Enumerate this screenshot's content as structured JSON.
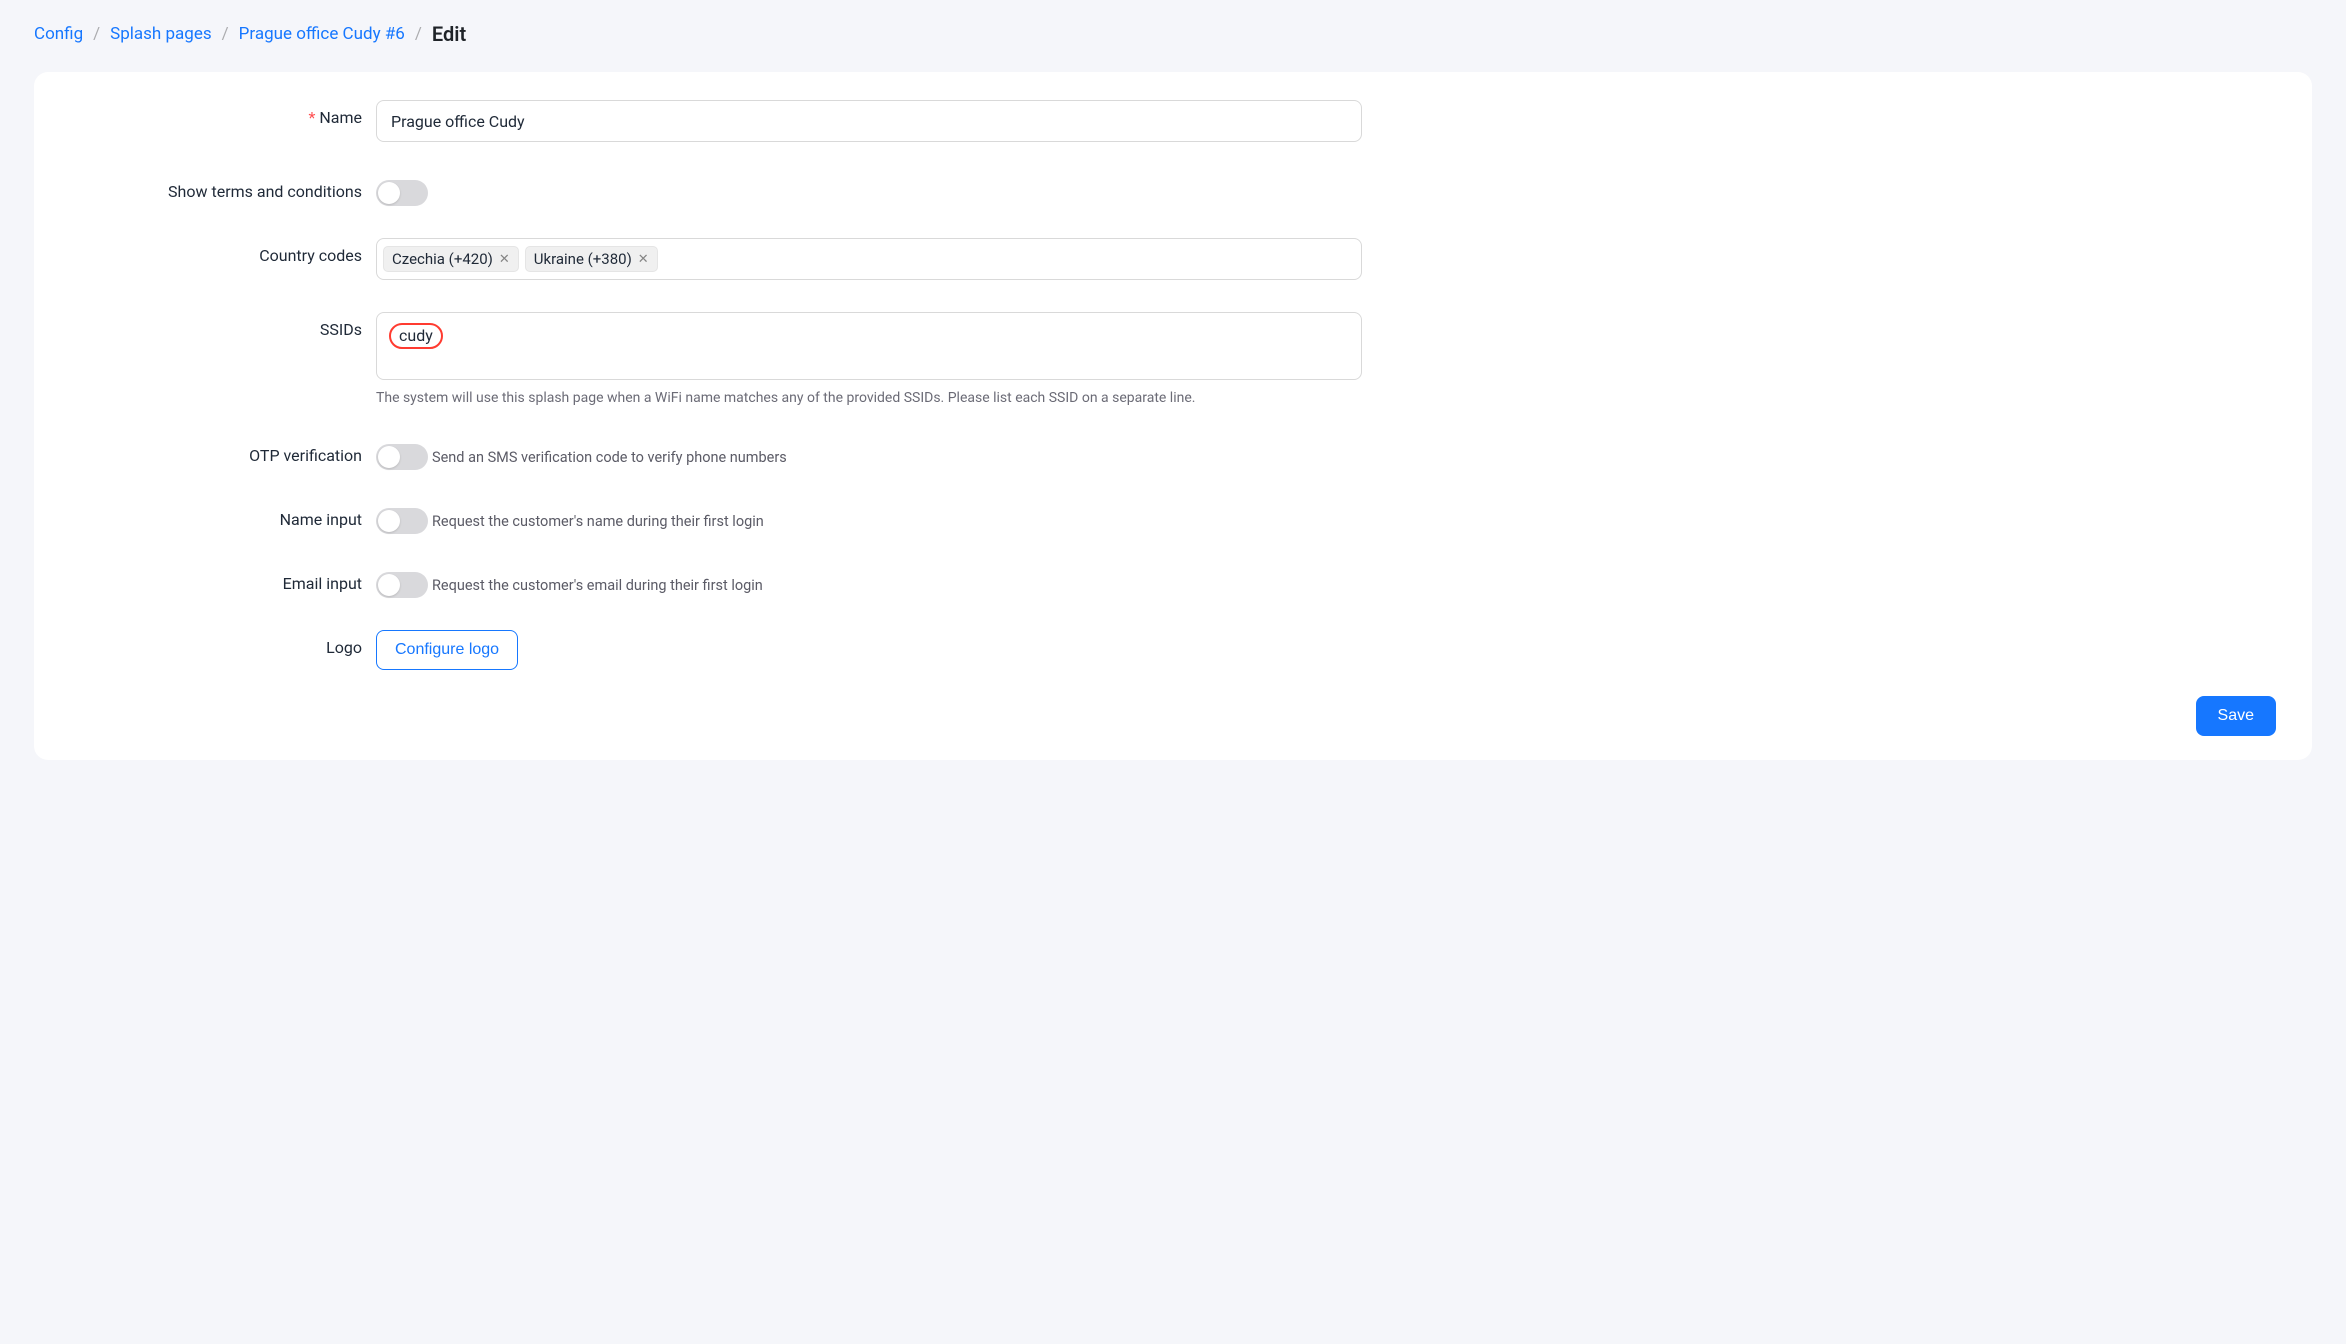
{
  "breadcrumb": {
    "items": [
      {
        "label": "Config"
      },
      {
        "label": "Splash pages"
      },
      {
        "label": "Prague office Cudy #6"
      }
    ],
    "current": "Edit"
  },
  "form": {
    "name": {
      "label": "Name",
      "value": "Prague office Cudy"
    },
    "terms": {
      "label": "Show terms and conditions"
    },
    "country_codes": {
      "label": "Country codes",
      "tags": [
        {
          "label": "Czechia (+420)"
        },
        {
          "label": "Ukraine (+380)"
        }
      ]
    },
    "ssids": {
      "label": "SSIDs",
      "value": "cudy",
      "help": "The system will use this splash page when a WiFi name matches any of the provided SSIDs. Please list each SSID on a separate line."
    },
    "otp": {
      "label": "OTP verification",
      "help": "Send an SMS verification code to verify phone numbers"
    },
    "name_input": {
      "label": "Name input",
      "help": "Request the customer's name during their first login"
    },
    "email_input": {
      "label": "Email input",
      "help": "Request the customer's email during their first login"
    },
    "logo": {
      "label": "Logo",
      "button": "Configure logo"
    }
  },
  "actions": {
    "save": "Save"
  }
}
